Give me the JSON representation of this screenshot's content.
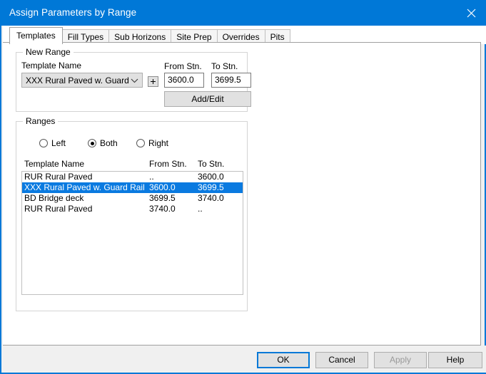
{
  "window": {
    "title": "Assign Parameters by Range",
    "close_icon": "close-icon",
    "accent_color": "#0078d7",
    "titlebar_bg": "#0078d7",
    "titlebar_text_color": "#ffffff"
  },
  "tabs": [
    {
      "label": "Templates",
      "active": true
    },
    {
      "label": "Fill Types",
      "active": false
    },
    {
      "label": "Sub Horizons",
      "active": false
    },
    {
      "label": "Site Prep",
      "active": false
    },
    {
      "label": "Overrides",
      "active": false
    },
    {
      "label": "Pits",
      "active": false
    }
  ],
  "new_range": {
    "group_title": "New Range",
    "template_name_label": "Template Name",
    "template_name_value": "XXX Rural Paved w. Guard Ra",
    "template_name_chevron": "chevron-down-icon",
    "add_template_button_label": "+",
    "from_stn_label": "From Stn.",
    "from_stn_value": "3600.0",
    "to_stn_label": "To Stn.",
    "to_stn_value": "3699.5",
    "add_edit_button_label": "Add/Edit"
  },
  "ranges": {
    "group_title": "Ranges",
    "side_options": [
      {
        "label": "Left",
        "selected": false
      },
      {
        "label": "Both",
        "selected": true
      },
      {
        "label": "Right",
        "selected": false
      }
    ],
    "columns": {
      "template_name": "Template Name",
      "from_stn": "From Stn.",
      "to_stn": "To Stn."
    },
    "rows": [
      {
        "template_name": "RUR Rural Paved",
        "from_stn": "..",
        "to_stn": "3600.0",
        "selected": false
      },
      {
        "template_name": "XXX Rural Paved w. Guard Rail",
        "from_stn": "3600.0",
        "to_stn": "3699.5",
        "selected": true
      },
      {
        "template_name": "BD Bridge deck",
        "from_stn": "3699.5",
        "to_stn": "3740.0",
        "selected": false
      },
      {
        "template_name": "RUR Rural Paved",
        "from_stn": "3740.0",
        "to_stn": "..",
        "selected": false
      }
    ],
    "selection_color": "#0a7ae0"
  },
  "footer": {
    "ok_label": "OK",
    "cancel_label": "Cancel",
    "apply_label": "Apply",
    "apply_disabled": true,
    "help_label": "Help"
  }
}
